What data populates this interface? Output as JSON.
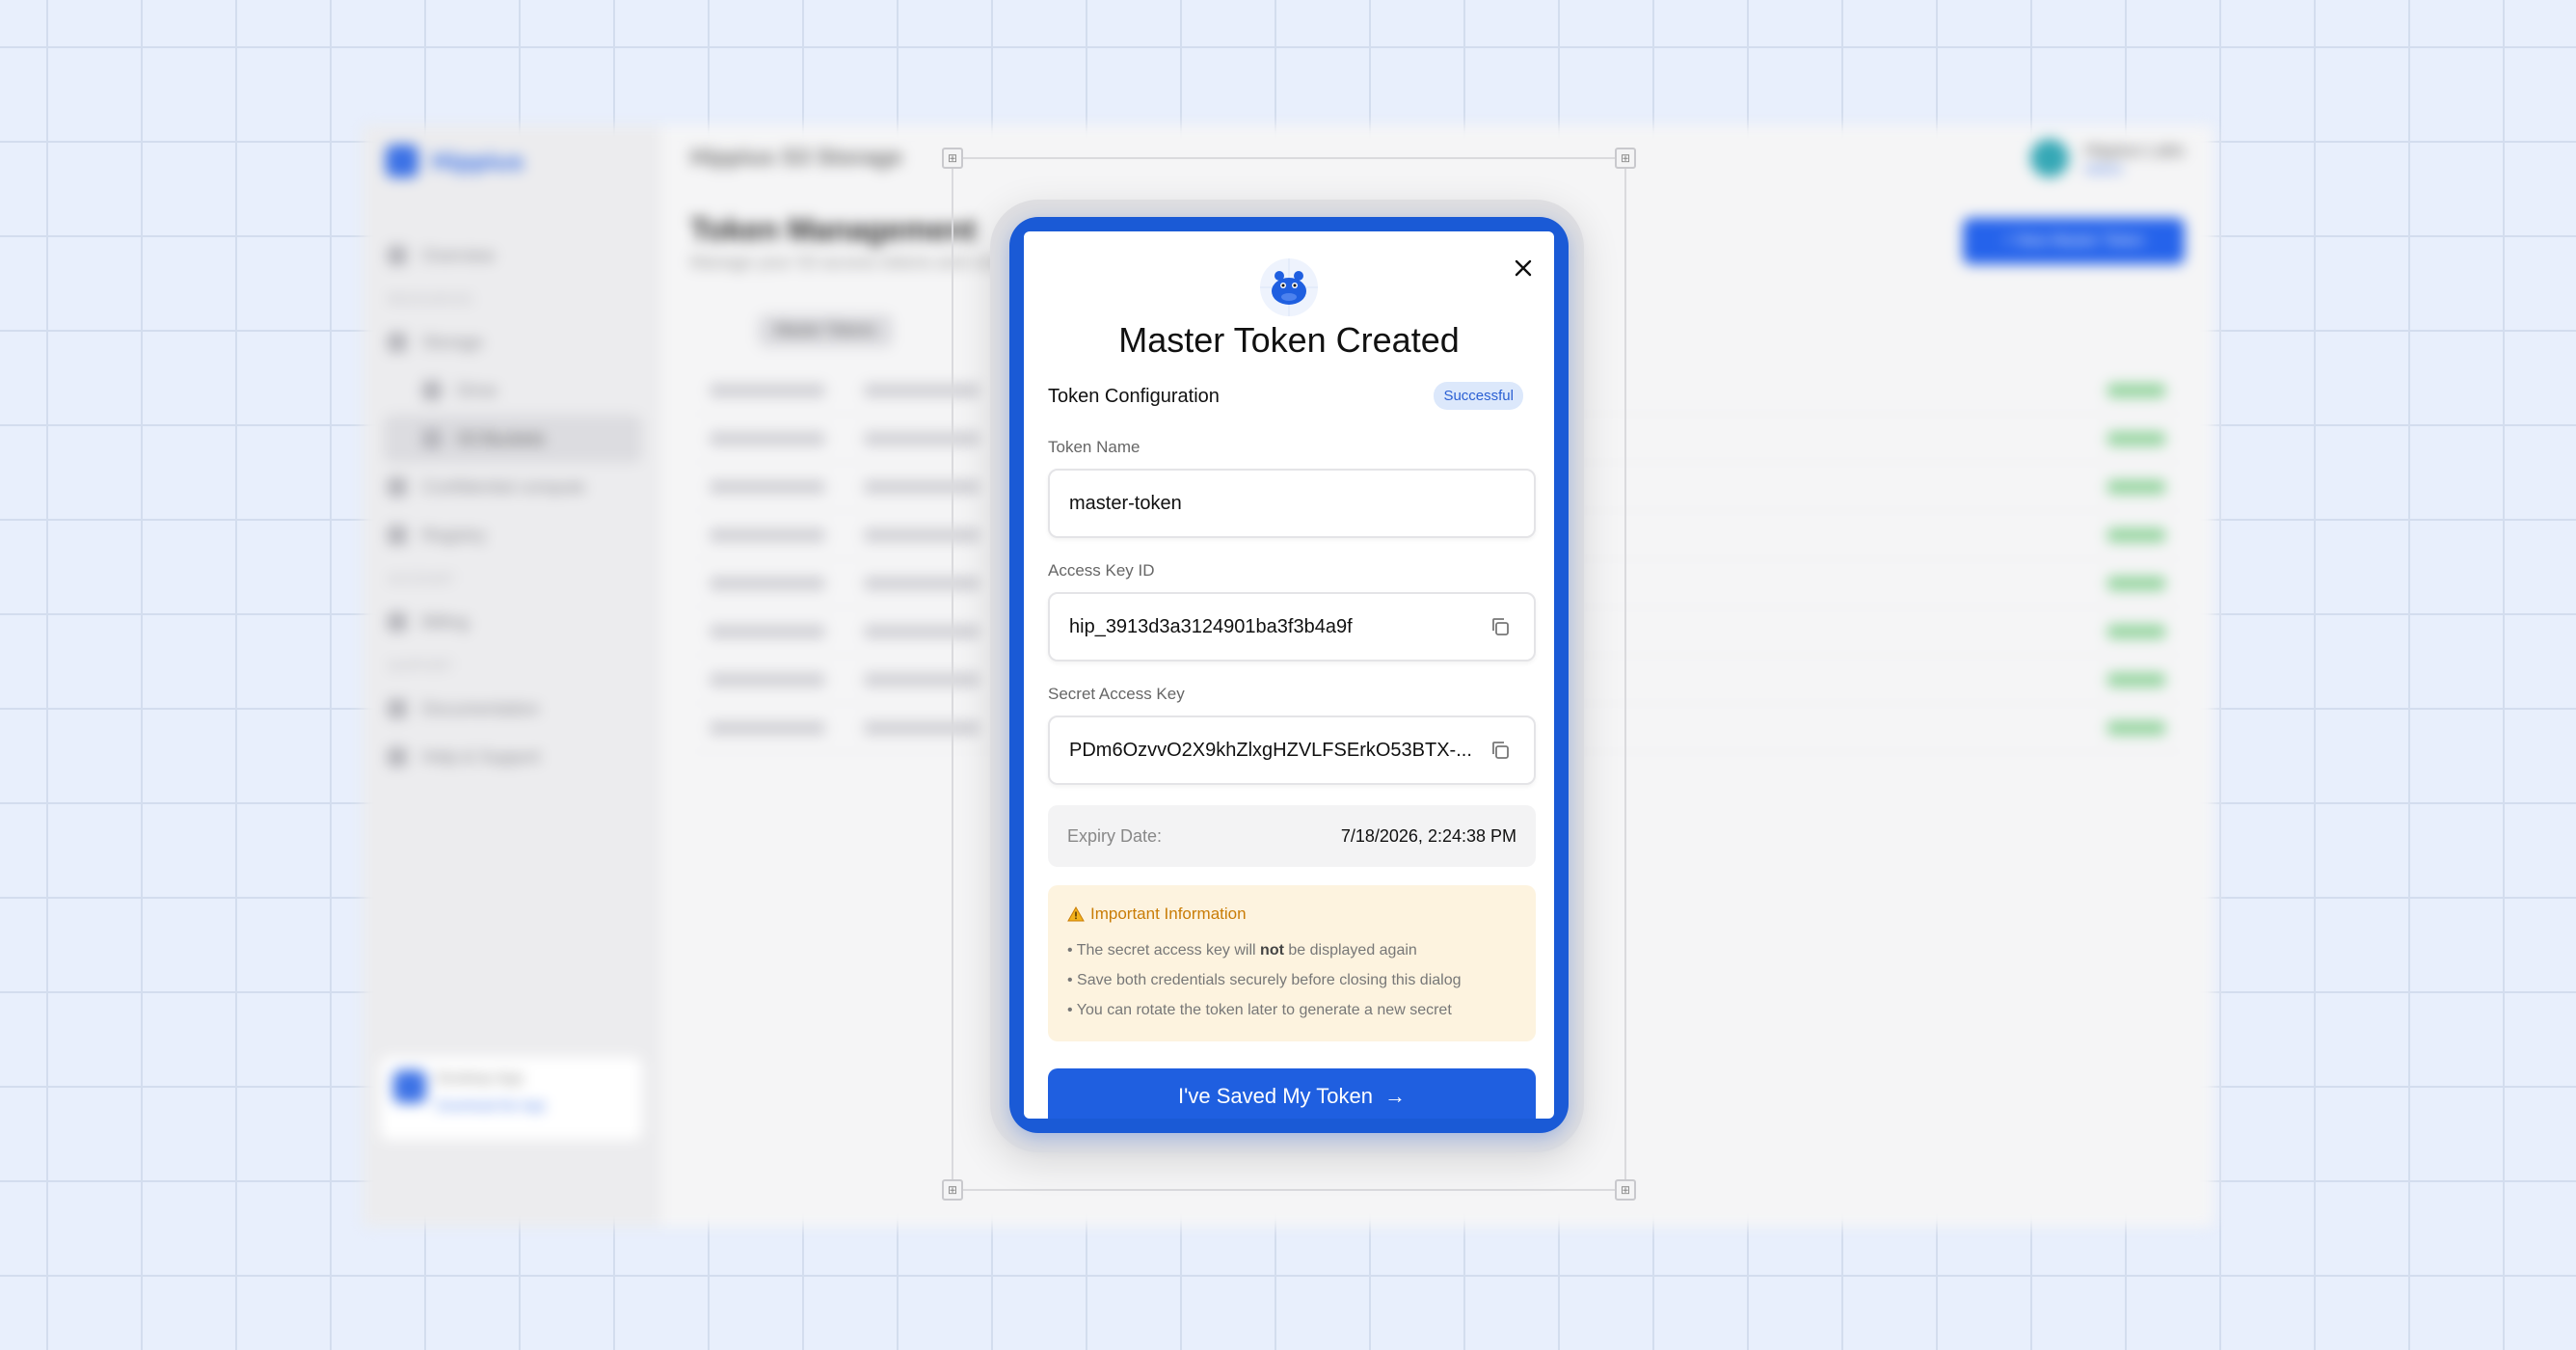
{
  "background_app": {
    "brand": {
      "name": "Hippius"
    },
    "nav": {
      "items": [
        "Overview",
        "Storage",
        "Drive",
        "S3 Buckets",
        "Confidential compute",
        "Registry",
        "Billing",
        "Documentation",
        "Help & Support"
      ],
      "sections": [
        "RESOURCES",
        "ACCOUNT",
        "SUPPORT"
      ]
    },
    "promo": {
      "title": "Desktop App",
      "link": "Download the App"
    },
    "topbar": {
      "title": "Hippius S3 Storage"
    },
    "user": {
      "name": "Hippius Labs",
      "role": "Admin"
    },
    "page": {
      "title": "Token Management",
      "subtitle": "Manage your S3 access tokens and credentials",
      "cta": "+ New Master Token",
      "filter": "Master Tokens"
    },
    "table_rows": 8
  },
  "dialog": {
    "title": "Master Token Created",
    "section_label": "Token Configuration",
    "badge": "Successful",
    "token_name_label": "Token Name",
    "token_name_value": "master-token",
    "access_key_label": "Access Key ID",
    "access_key_value": "hip_3913d3a3124901ba3f3b4a9f",
    "secret_key_label": "Secret Access Key",
    "secret_key_value": "PDm6OzvvO2X9khZlxgHZVLFSErkO53BTX-...",
    "expiry_label": "Expiry Date:",
    "expiry_value": "7/18/2026, 2:24:38 PM",
    "warning": {
      "title": "Important Information",
      "line1_pre": "• The secret access key will ",
      "line1_bold": "not",
      "line1_post": " be displayed again",
      "line2": "• Save both credentials securely before closing this dialog",
      "line3": "• You can rotate the token later to generate a new secret"
    },
    "cta_label": "I've Saved My Token",
    "cta_arrow": "→"
  },
  "colors": {
    "accent": "#1f5fe0",
    "badge_bg": "#dce8fb",
    "warning_bg": "#fdf3df",
    "warning_text": "#c97c06"
  },
  "icons": {
    "close": "close-icon",
    "copy": "copy-icon",
    "warning": "warning-icon",
    "mascot": "hippo-mascot-icon",
    "arrow": "arrow-right-icon"
  }
}
